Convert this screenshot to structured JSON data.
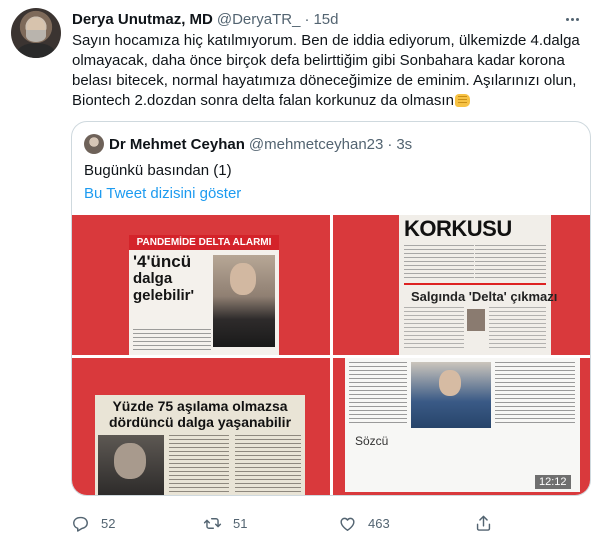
{
  "author": {
    "name": "Derya Unutmaz, MD",
    "handle": "@DeryaTR_",
    "separator": "·",
    "time": "15d"
  },
  "tweet_lines": [
    "Sayın hocamıza hiç katılmıyorum. Ben de iddia ediyorum, ülkemizde 4.dalga",
    "olmayacak, daha önce birçok defa belirttiğim gibi Sonbahara kadar korona",
    "belası bitecek, normal hayatımıza döneceğimize de eminim. Aşılarınızı olun,",
    "Biontech 2.dozdan sonra delta falan korkunuz da olmasın"
  ],
  "quote": {
    "name": "Dr Mehmet Ceyhan",
    "handle": "@mehmetceyhan23",
    "separator": "·",
    "time": "3s",
    "text": "Bugünkü basından (1)",
    "thread_link": "Bu Tweet dizisini göster"
  },
  "media": {
    "tile1": {
      "banner": "PANDEMİDE DELTA ALARMI",
      "headline_1": "'4'üncü",
      "headline_2": "dalga",
      "headline_3": "gelebilir'"
    },
    "tile2": {
      "big": "KORKUSU",
      "sub": "Salgında 'Delta' çıkmazı"
    },
    "tile3": {
      "h1_a": "Yüzde 75 aşılama olmazsa",
      "h2_a": "dördüncü dalga ",
      "h2_b": "yaşanabilir"
    },
    "tile4": {
      "brand": "Sözcü",
      "stamp": "12:12"
    }
  },
  "actions": {
    "reply_count": "52",
    "retweet_count": "51",
    "like_count": "463"
  },
  "colors": {
    "link": "#1d9bf0",
    "secondary_text": "#536471",
    "border": "#cfd9de",
    "media_background": "#d9393c"
  }
}
